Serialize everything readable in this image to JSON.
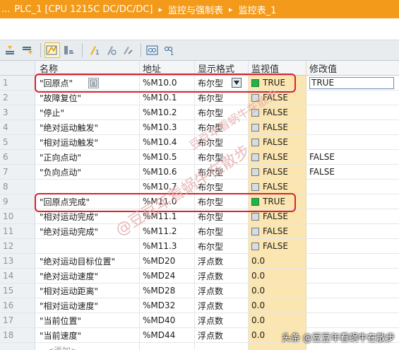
{
  "titlebar": {
    "prefix": "...",
    "crumb1": "PLC_1 [CPU 1215C DC/DC/DC]",
    "crumb2": "监控与强制表",
    "crumb3": "监控表_1",
    "separator": "▸"
  },
  "toolbar": {
    "icons": [
      "insert-row-icon",
      "add-row-icon",
      "monitor-toggle-icon",
      "display-format-icon",
      "modify-now-icon",
      "modify-trigger-icon",
      "enable-periphery-icon",
      "monitor-all-icon",
      "monitor-once-icon"
    ]
  },
  "header": {
    "name": "名称",
    "address": "地址",
    "format": "显示格式",
    "monitor": "监视值",
    "modify": "修改值"
  },
  "rows": [
    {
      "idx": "1",
      "name": "\"回原点\"",
      "address": "%M10.0",
      "format": "布尔型",
      "monitor": "TRUE",
      "on": true,
      "modify": "TRUE"
    },
    {
      "idx": "2",
      "name": "\"故障复位\"",
      "address": "%M10.1",
      "format": "布尔型",
      "monitor": "FALSE",
      "on": false,
      "modify": ""
    },
    {
      "idx": "3",
      "name": "\"停止\"",
      "address": "%M10.2",
      "format": "布尔型",
      "monitor": "FALSE",
      "on": false,
      "modify": ""
    },
    {
      "idx": "4",
      "name": "\"绝对运动触发\"",
      "address": "%M10.3",
      "format": "布尔型",
      "monitor": "FALSE",
      "on": false,
      "modify": ""
    },
    {
      "idx": "5",
      "name": "\"相对运动触发\"",
      "address": "%M10.4",
      "format": "布尔型",
      "monitor": "FALSE",
      "on": false,
      "modify": ""
    },
    {
      "idx": "6",
      "name": "\"正向点动\"",
      "address": "%M10.5",
      "format": "布尔型",
      "monitor": "FALSE",
      "on": false,
      "modify": "FALSE"
    },
    {
      "idx": "7",
      "name": "\"负向点动\"",
      "address": "%M10.6",
      "format": "布尔型",
      "monitor": "FALSE",
      "on": false,
      "modify": "FALSE"
    },
    {
      "idx": "8",
      "name": "",
      "address": "%M10.7",
      "format": "布尔型",
      "monitor": "FALSE",
      "on": false,
      "modify": ""
    },
    {
      "idx": "9",
      "name": "\"回原点完成\"",
      "address": "%M11.0",
      "format": "布尔型",
      "monitor": "TRUE",
      "on": true,
      "modify": ""
    },
    {
      "idx": "10",
      "name": "\"相对运动完成\"",
      "address": "%M11.1",
      "format": "布尔型",
      "monitor": "FALSE",
      "on": false,
      "modify": ""
    },
    {
      "idx": "11",
      "name": "\"绝对运动完成\"",
      "address": "%M11.2",
      "format": "布尔型",
      "monitor": "FALSE",
      "on": false,
      "modify": ""
    },
    {
      "idx": "12",
      "name": "",
      "address": "%M11.3",
      "format": "布尔型",
      "monitor": "FALSE",
      "on": false,
      "modify": ""
    },
    {
      "idx": "13",
      "name": "\"绝对运动目标位置\"",
      "address": "%MD20",
      "format": "浮点数",
      "monitor": "0.0",
      "on": null,
      "modify": ""
    },
    {
      "idx": "14",
      "name": "\"绝对运动速度\"",
      "address": "%MD24",
      "format": "浮点数",
      "monitor": "0.0",
      "on": null,
      "modify": ""
    },
    {
      "idx": "15",
      "name": "\"相对运动距离\"",
      "address": "%MD28",
      "format": "浮点数",
      "monitor": "0.0",
      "on": null,
      "modify": ""
    },
    {
      "idx": "16",
      "name": "\"相对运动速度\"",
      "address": "%MD32",
      "format": "浮点数",
      "monitor": "0.0",
      "on": null,
      "modify": ""
    },
    {
      "idx": "17",
      "name": "\"当前位置\"",
      "address": "%MD40",
      "format": "浮点数",
      "monitor": "0.0",
      "on": null,
      "modify": ""
    },
    {
      "idx": "18",
      "name": "\"当前速度\"",
      "address": "%MD44",
      "format": "浮点数",
      "monitor": "0.0",
      "on": null,
      "modify": ""
    }
  ],
  "add_row": "<添加>",
  "watermark": {
    "diagonal1": "@豆豆年看蜗牛在散步",
    "diagonal2": "豆豆年看蜗牛在散步",
    "footer": "头条 @豆豆年看蜗牛在散步"
  },
  "colors": {
    "title_orange": "#f39a1a",
    "monitor_bg": "#fbe6b1",
    "true_green": "#21b24b",
    "highlight_red": "#d8222b"
  }
}
